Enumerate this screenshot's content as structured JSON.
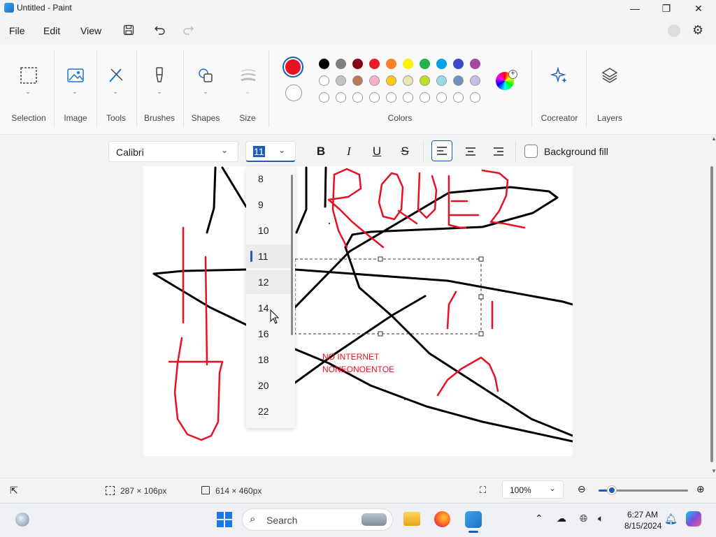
{
  "window": {
    "title": "Untitled - Paint",
    "minimize": "—",
    "maximize": "❐",
    "close": "✕"
  },
  "menu": {
    "file": "File",
    "edit": "Edit",
    "view": "View"
  },
  "ribbon": {
    "groups": {
      "selection": "Selection",
      "image": "Image",
      "tools": "Tools",
      "brushes": "Brushes",
      "shapes": "Shapes",
      "size": "Size",
      "colors": "Colors",
      "cocreator": "Cocreator",
      "layers": "Layers"
    },
    "primary_color": "#e81123",
    "secondary_color": "#ffffff",
    "palette_row1": [
      "#000000",
      "#7f7f7f",
      "#880015",
      "#ed1c24",
      "#ff7f27",
      "#fff200",
      "#22b14c",
      "#00a2e8",
      "#3f48cc",
      "#a349a4"
    ],
    "palette_row2": [
      "#ffffff",
      "#c3c3c3",
      "#b97a57",
      "#ffaec9",
      "#ffc90e",
      "#efe4b0",
      "#b5e61d",
      "#99d9ea",
      "#7092be",
      "#c8bfe7"
    ],
    "palette_row3": [
      "#ffffff",
      "#ffffff",
      "#ffffff",
      "#ffffff",
      "#ffffff",
      "#ffffff",
      "#ffffff",
      "#ffffff",
      "#ffffff",
      "#ffffff"
    ]
  },
  "text_toolbar": {
    "font": "Calibri",
    "size": "11",
    "bold": "B",
    "italic": "I",
    "underline": "U",
    "strike": "S",
    "background_fill": "Background fill"
  },
  "font_size_options": [
    "8",
    "9",
    "10",
    "11",
    "12",
    "14",
    "16",
    "18",
    "20",
    "22"
  ],
  "selected_font_size": "11",
  "canvas_text": [
    "NO INTERNET",
    "NONEONOENTOE"
  ],
  "status": {
    "selection_size": "287 × 106px",
    "canvas_size": "614 × 460px",
    "zoom": "100%",
    "zoom_slider_fraction": 0.15
  },
  "taskbar": {
    "search": "Search",
    "time": "6:27 AM",
    "date": "8/15/2024"
  }
}
